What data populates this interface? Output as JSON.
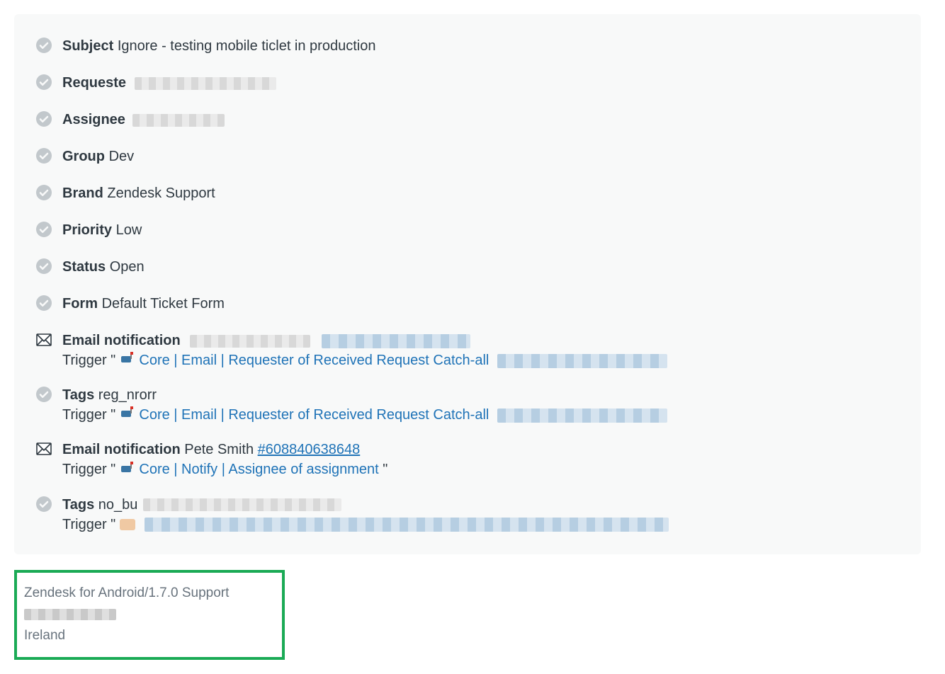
{
  "events": {
    "subject": {
      "label": "Subject",
      "value": "Ignore - testing mobile ticlet in production"
    },
    "requester": {
      "label": "Requeste"
    },
    "assignee": {
      "label": "Assignee"
    },
    "group": {
      "label": "Group",
      "value": "Dev"
    },
    "brand": {
      "label": "Brand",
      "value": "Zendesk Support"
    },
    "priority": {
      "label": "Priority",
      "value": "Low"
    },
    "status": {
      "label": "Status",
      "value": "Open"
    },
    "form": {
      "label": "Form",
      "value": "Default Ticket Form"
    },
    "email_notif_1": {
      "label": "Email notification",
      "trigger_prefix": "Trigger \"",
      "trigger_link": "Core | Email | Requester of Received Request Catch-all"
    },
    "tags_1": {
      "label": "Tags",
      "value": "reg_nrorr",
      "trigger_prefix": "Trigger \"",
      "trigger_link": "Core | Email | Requester of Received Request Catch-all"
    },
    "email_notif_2": {
      "label": "Email notification",
      "value": "Pete Smith",
      "ref": "#608840638648",
      "trigger_prefix": "Trigger \"",
      "trigger_link": "Core | Notify | Assignee of assignment",
      "trigger_suffix": "\""
    },
    "tags_2": {
      "label": "Tags",
      "value": "no_bu",
      "trigger_prefix": "Trigger \""
    }
  },
  "footer": {
    "line1": "Zendesk for Android/1.7.0 Support",
    "line3": "Ireland"
  }
}
